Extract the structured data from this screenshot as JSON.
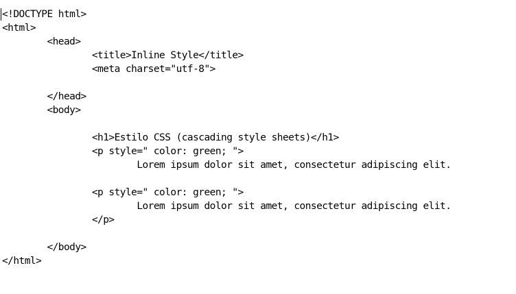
{
  "editor": {
    "lines": [
      "<!DOCTYPE html>",
      "<html>",
      "        <head>",
      "                <title>Inline Style</title>",
      "                <meta charset=\"utf-8\">",
      "",
      "        </head>",
      "        <body>",
      "",
      "                <h1>Estilo CSS (cascading style sheets)</h1>",
      "                <p style=\" color: green; \">",
      "                        Lorem ipsum dolor sit amet, consectetur adipiscing elit.",
      "",
      "                <p style=\" color: green; \">",
      "                        Lorem ipsum dolor sit amet, consectetur adipiscing elit.",
      "                </p>",
      "",
      "        </body>",
      "</html>"
    ]
  }
}
